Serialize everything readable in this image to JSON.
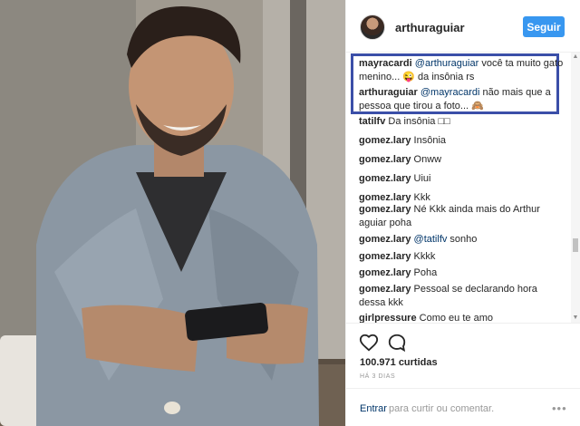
{
  "post": {
    "username": "arthuraguiar",
    "follow_label": "Seguir"
  },
  "comments": [
    {
      "user": "mayracardi",
      "mention": "@arthuraguiar",
      "text": " você ta muito gato menino... 😜 da insônia rs"
    },
    {
      "user": "arthuraguiar",
      "mention": "@mayracardi",
      "text": " não mais que a pessoa que tirou a foto... 🙈"
    },
    {
      "user": "tatilfv",
      "mention": "",
      "text": "Da insônia □□"
    },
    {
      "user": "gomez.lary",
      "mention": "",
      "text": "Insônia"
    },
    {
      "user": "gomez.lary",
      "mention": "",
      "text": "Onww"
    },
    {
      "user": "gomez.lary",
      "mention": "",
      "text": "Uiui"
    },
    {
      "user": "gomez.lary",
      "mention": "",
      "text": "Kkk"
    },
    {
      "user": "gomez.lary",
      "mention": "",
      "text": "Né Kkk ainda mais do Arthur aguiar poha"
    },
    {
      "user": "gomez.lary",
      "mention": "@tatilfv",
      "text": " sonho"
    },
    {
      "user": "gomez.lary",
      "mention": "",
      "text": "Kkkk"
    },
    {
      "user": "gomez.lary",
      "mention": "",
      "text": "Poha"
    },
    {
      "user": "gomez.lary",
      "mention": "",
      "text": "Pessoal se declarando hora dessa kkk"
    },
    {
      "user": "girlpressure",
      "mention": "",
      "text": "Como eu te amo"
    }
  ],
  "likes": "100.971 curtidas",
  "time": "HÁ 3 DIAS",
  "add_comment": {
    "login_link": "Entrar",
    "rest_text": "para curtir ou comentar.",
    "more_icon": "•••"
  },
  "icons": {
    "like": "heart-icon",
    "comment": "comment-icon",
    "more": "more-options-icon"
  },
  "colors": {
    "follow_button": "#3897f0",
    "highlight_border": "#3b4fa8",
    "link": "#003569"
  }
}
